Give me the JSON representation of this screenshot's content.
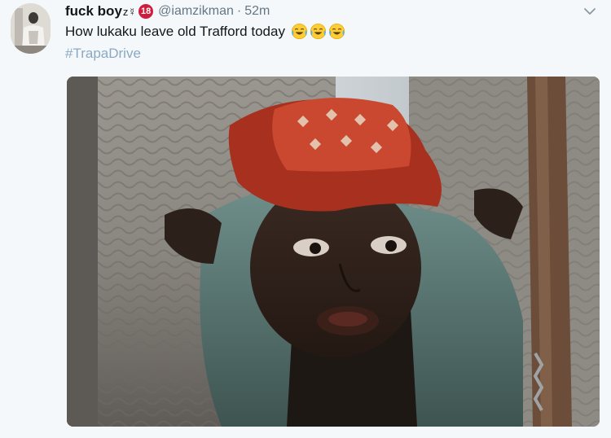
{
  "user": {
    "display_name": "fuck boy",
    "name_symbols": "z☿",
    "badge": "18",
    "handle": "@iamzikman",
    "separator": "·",
    "timestamp": "52m"
  },
  "tweet": {
    "text": "How lukaku leave old Trafford today",
    "emojis": [
      "face-with-tears-of-joy-icon",
      "face-with-tears-of-joy-icon",
      "face-with-tears-of-joy-icon"
    ],
    "hashtag": "#TrapaDrive"
  },
  "colors": {
    "background": "#f5f8fa",
    "handle": "#657786",
    "hashtag": "#8aa9c4",
    "badge": "#cf1d3c"
  }
}
